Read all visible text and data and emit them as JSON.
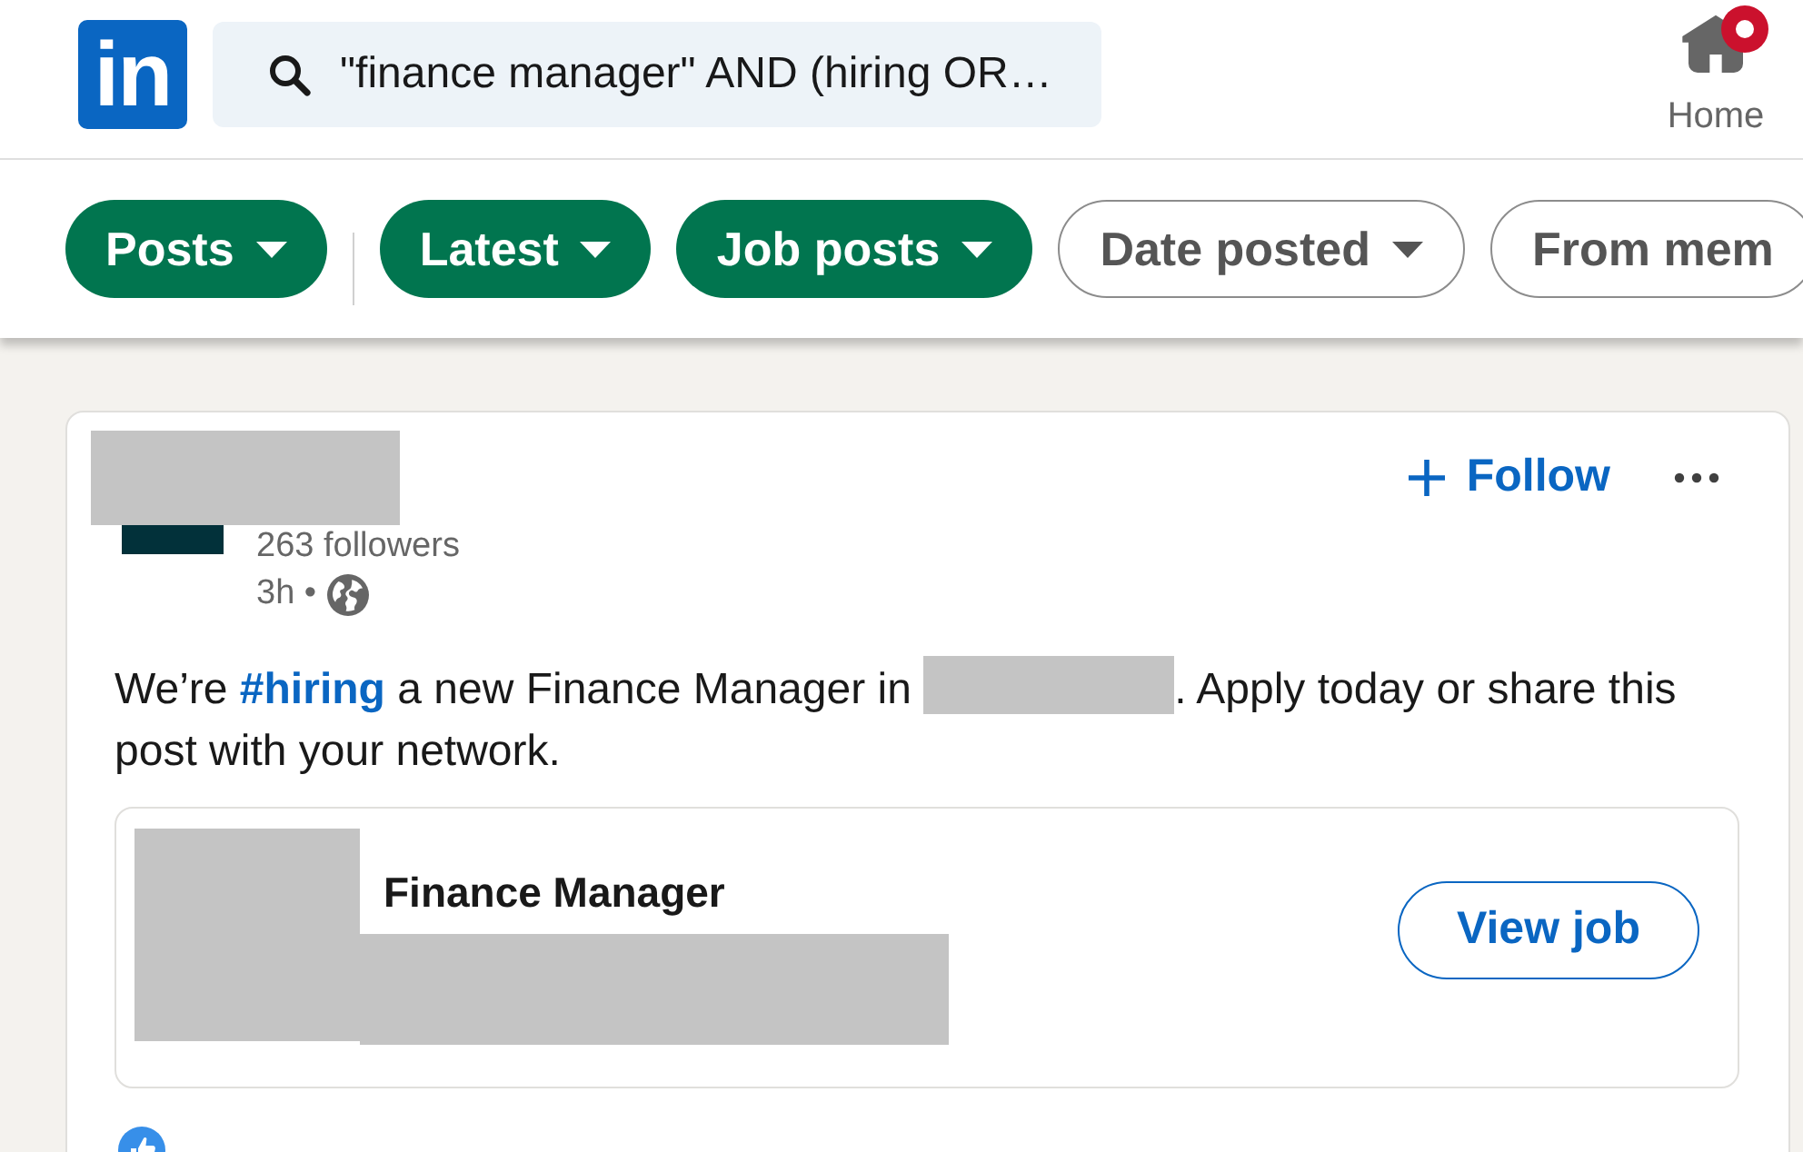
{
  "header": {
    "logo": {
      "text": "in"
    },
    "search": {
      "value": "\"finance manager\" AND (hiring OR…"
    },
    "nav": [
      {
        "label": "Home",
        "selected": false,
        "notification": true
      }
    ]
  },
  "filters": {
    "type": {
      "label": "Posts",
      "selected": true,
      "dropdown": true
    },
    "options": [
      {
        "label": "Latest",
        "selected": true,
        "dropdown": true
      },
      {
        "label": "Job posts",
        "selected": true,
        "dropdown": true
      },
      {
        "label": "Date posted",
        "selected": false,
        "dropdown": true
      },
      {
        "label": "From mem",
        "selected": false,
        "dropdown": false
      }
    ]
  },
  "post": {
    "followers": "263 followers",
    "time": "3h •",
    "follow_button": "Follow",
    "text": [
      {
        "kind": "text",
        "text": "We’re"
      },
      {
        "kind": "hashtag",
        "text": "#hiring"
      },
      {
        "kind": "text",
        "text": "a new Finance Manager in"
      },
      {
        "kind": "redacted"
      },
      {
        "kind": "text",
        "text": ". Apply today or share this"
      },
      {
        "kind": "break"
      },
      {
        "kind": "text",
        "text": "post with your network."
      }
    ],
    "job": {
      "title": "Finance Manager",
      "button": "View job"
    }
  }
}
